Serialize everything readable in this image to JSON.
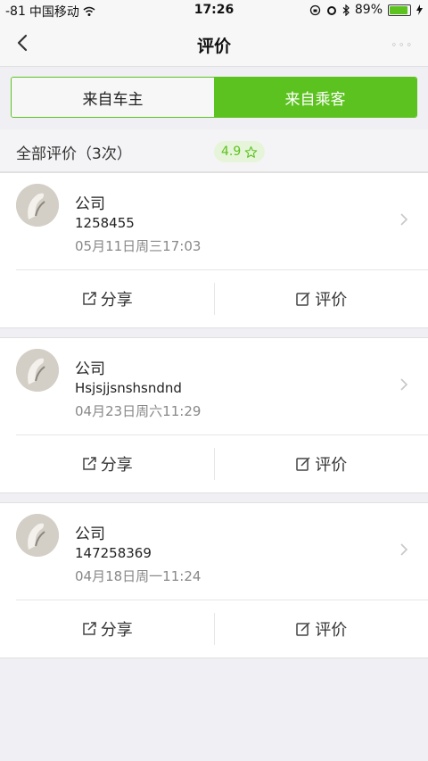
{
  "status_bar": {
    "signal": "-81",
    "carrier": "中国移动",
    "time": "17:26",
    "battery": "89%"
  },
  "nav": {
    "title": "评价",
    "more": "◦◦◦"
  },
  "segment": {
    "tabs": [
      {
        "label": "来自车主",
        "selected": false
      },
      {
        "label": "来自乘客",
        "selected": true
      }
    ]
  },
  "summary": {
    "label": "全部评价（3次）",
    "rating": "4.9"
  },
  "reviews": [
    {
      "title": "公司",
      "content": "1258455",
      "time": "05月11日周三17:03",
      "share_label": "分享",
      "review_label": "评价"
    },
    {
      "title": "公司",
      "content": "Hsjsjjsnshsndnd",
      "time": "04月23日周六11:29",
      "share_label": "分享",
      "review_label": "评价"
    },
    {
      "title": "公司",
      "content": "147258369",
      "time": "04月18日周一11:24",
      "share_label": "分享",
      "review_label": "评价"
    }
  ],
  "colors": {
    "accent": "#5cc21f",
    "background": "#efeff4"
  },
  "icons": [
    "back-chevron-icon",
    "wifi-icon",
    "lock-rotation-icon",
    "alarm-icon",
    "bluetooth-icon",
    "battery-icon",
    "charging-icon",
    "star-icon",
    "share-icon",
    "edit-icon",
    "chevron-right-icon"
  ]
}
